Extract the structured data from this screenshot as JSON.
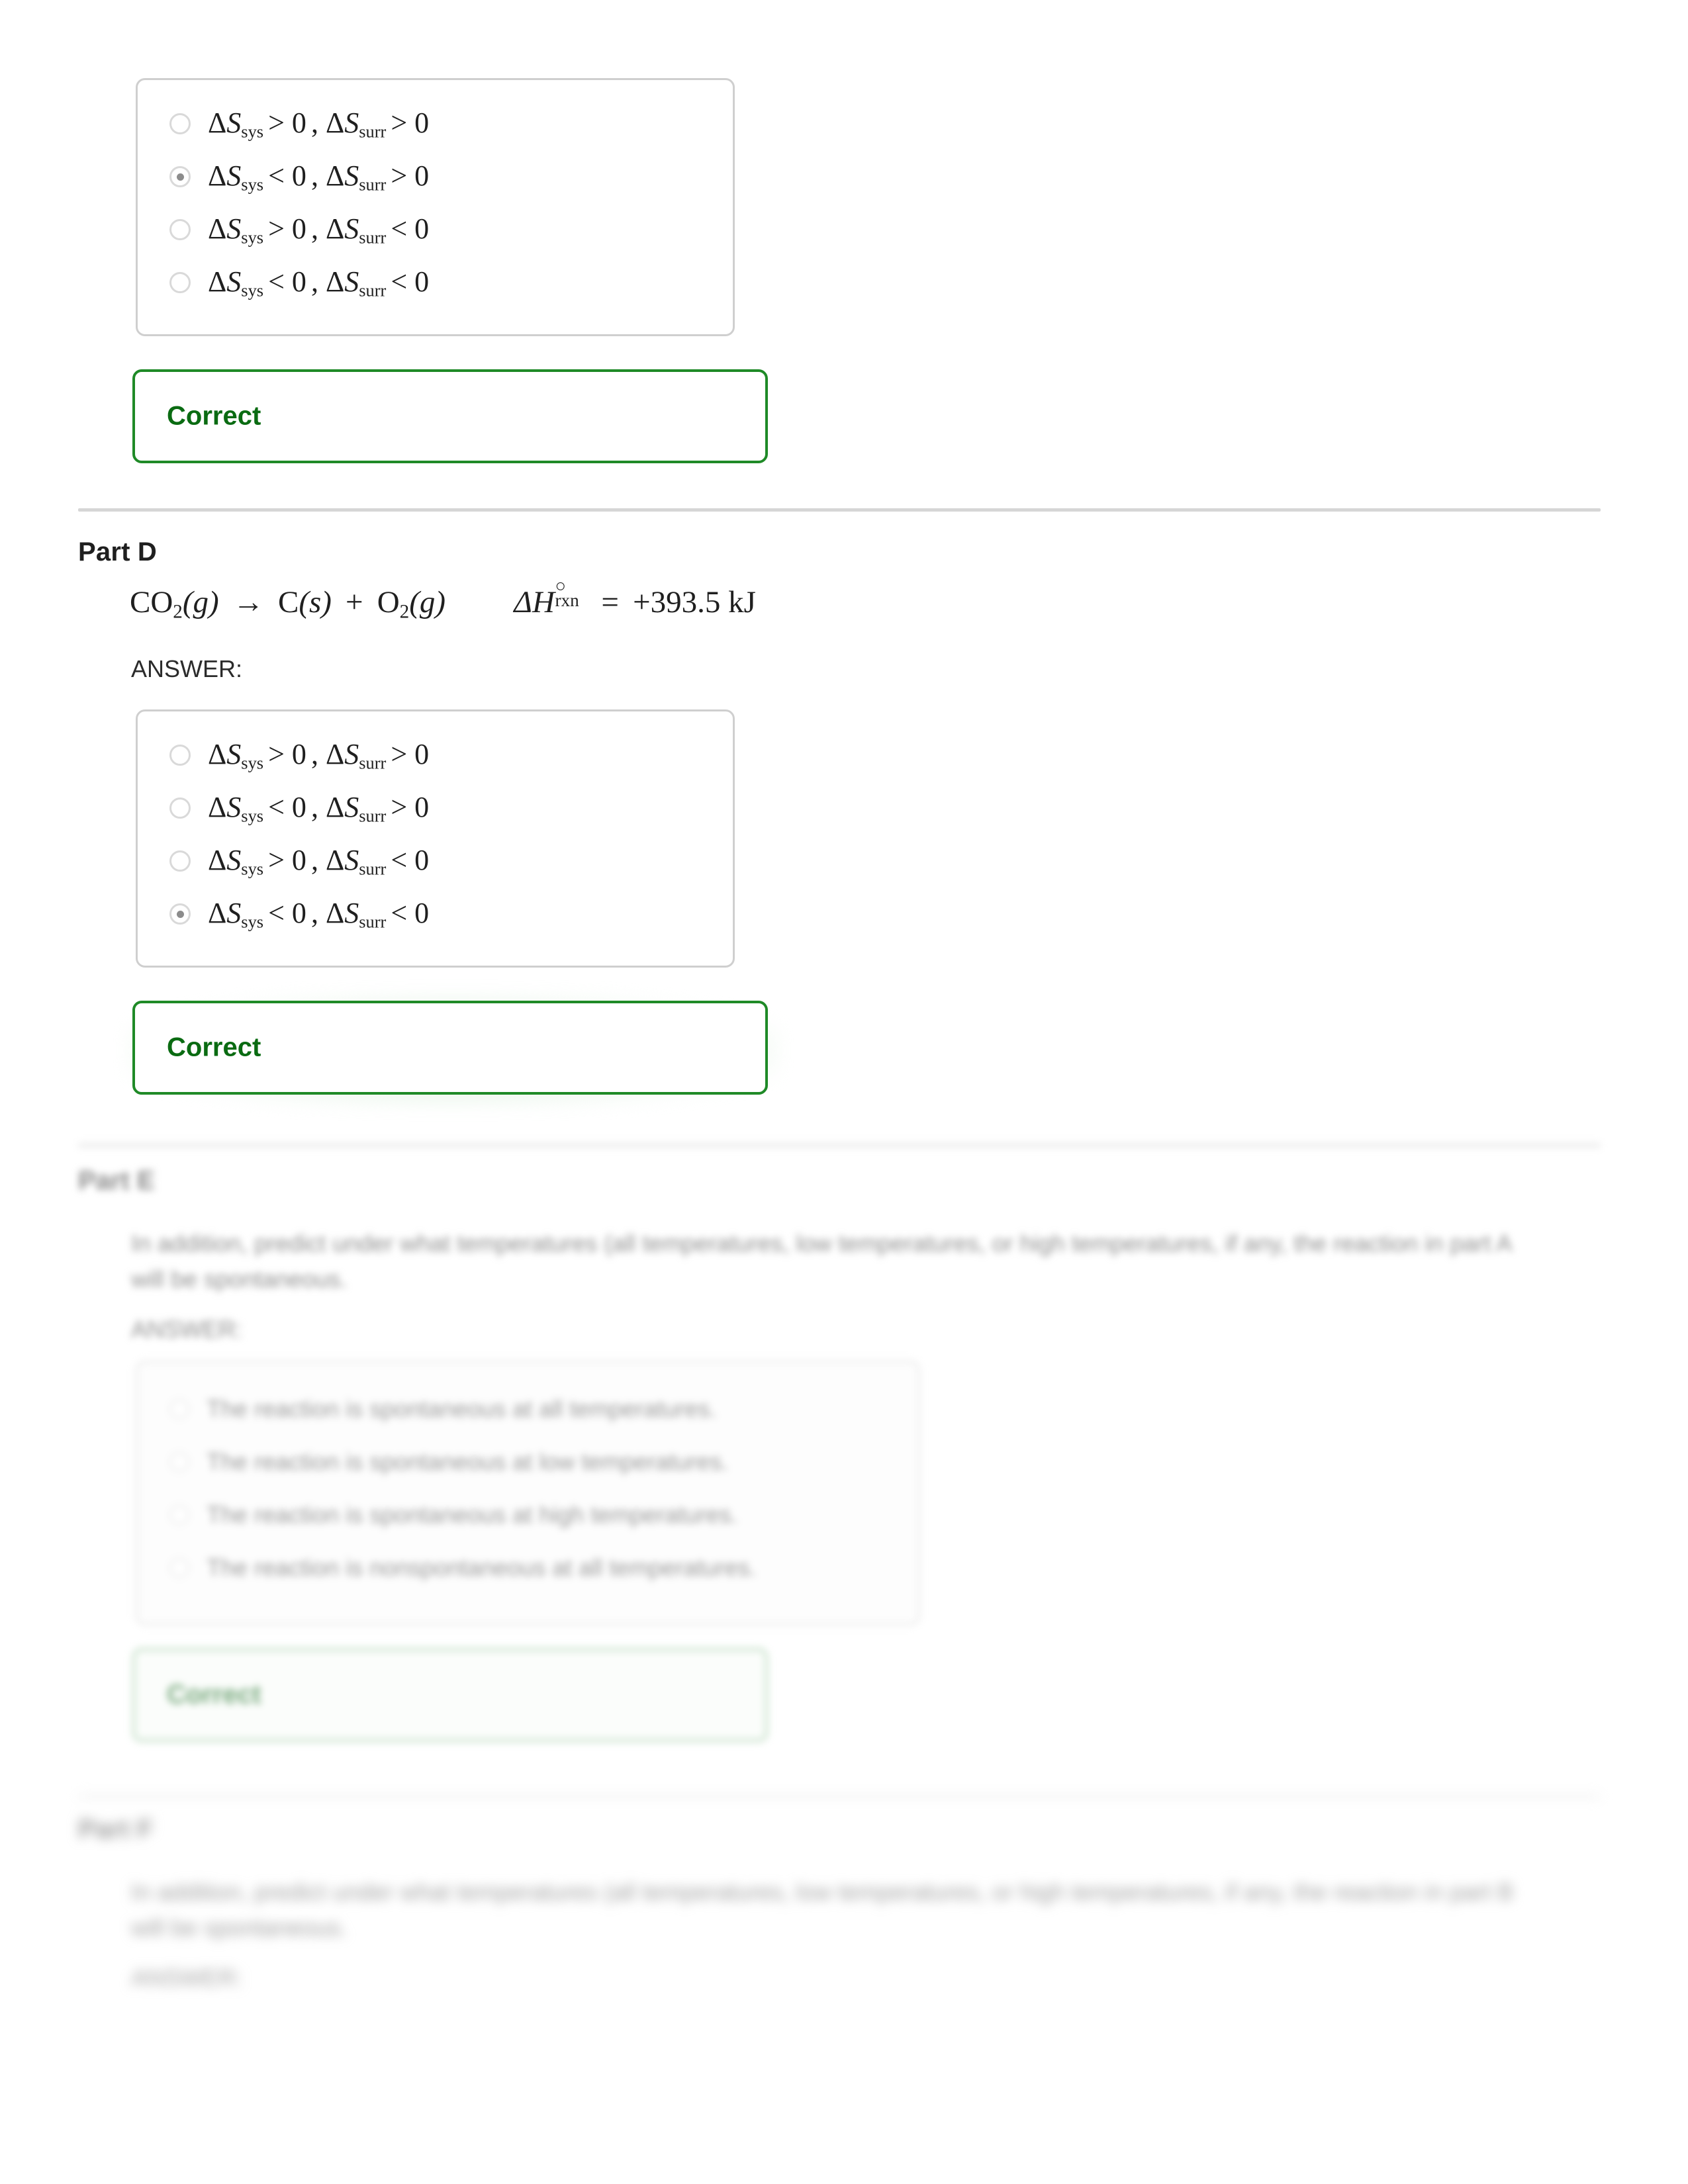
{
  "entropy_options": [
    {
      "sys": "> 0",
      "surr": "> 0"
    },
    {
      "sys": "< 0",
      "surr": "> 0"
    },
    {
      "sys": "> 0",
      "surr": "< 0"
    },
    {
      "sys": "< 0",
      "surr": "< 0"
    }
  ],
  "symbols": {
    "delta": "Δ",
    "S": "S",
    "sub_sys": "sys",
    "sub_surr": "surr",
    "comma": ",",
    "arrow": "→",
    "plus": "+",
    "equals": "=",
    "degree": "○"
  },
  "part_c": {
    "selected_index": 1,
    "feedback": "Correct"
  },
  "part_d": {
    "heading": "Part D",
    "answer_label": "ANSWER:",
    "equation": {
      "reactant": "CO",
      "reactant_sub": "2",
      "reactant_state": "(g)",
      "arrow": "→",
      "product1": "C",
      "product1_state": "(s)",
      "plus": "+",
      "product2": "O",
      "product2_sub": "2",
      "product2_state": "(g)",
      "enthalpy_symbol": "ΔH",
      "enthalpy_sup": "○",
      "enthalpy_sub": "rxn",
      "equals": "=",
      "enthalpy_value": "+393.5 kJ"
    },
    "selected_index": 3,
    "feedback": "Correct"
  },
  "part_e": {
    "heading": "Part E",
    "prompt": "In addition, predict under what temperatures (all temperatures, low temperatures, or high temperatures, if any, the reaction in part A will be spontaneous.",
    "answer_label": "ANSWER:",
    "options": [
      "The reaction is spontaneous at all temperatures.",
      "The reaction is spontaneous at low temperatures.",
      "The reaction is spontaneous at high temperatures.",
      "The reaction is nonspontaneous at all temperatures."
    ],
    "feedback": "Correct"
  },
  "part_f": {
    "heading": "Part F",
    "prompt": "In addition, predict under what temperatures (all temperatures, low temperatures, or high temperatures, if any, the reaction in part B will be spontaneous.",
    "answer_label": "ANSWER:"
  },
  "colors": {
    "correct_border": "#1f8a27",
    "correct_text": "#0a6b12",
    "box_border": "#cfcfcf",
    "divider": "#d6d6d6"
  }
}
